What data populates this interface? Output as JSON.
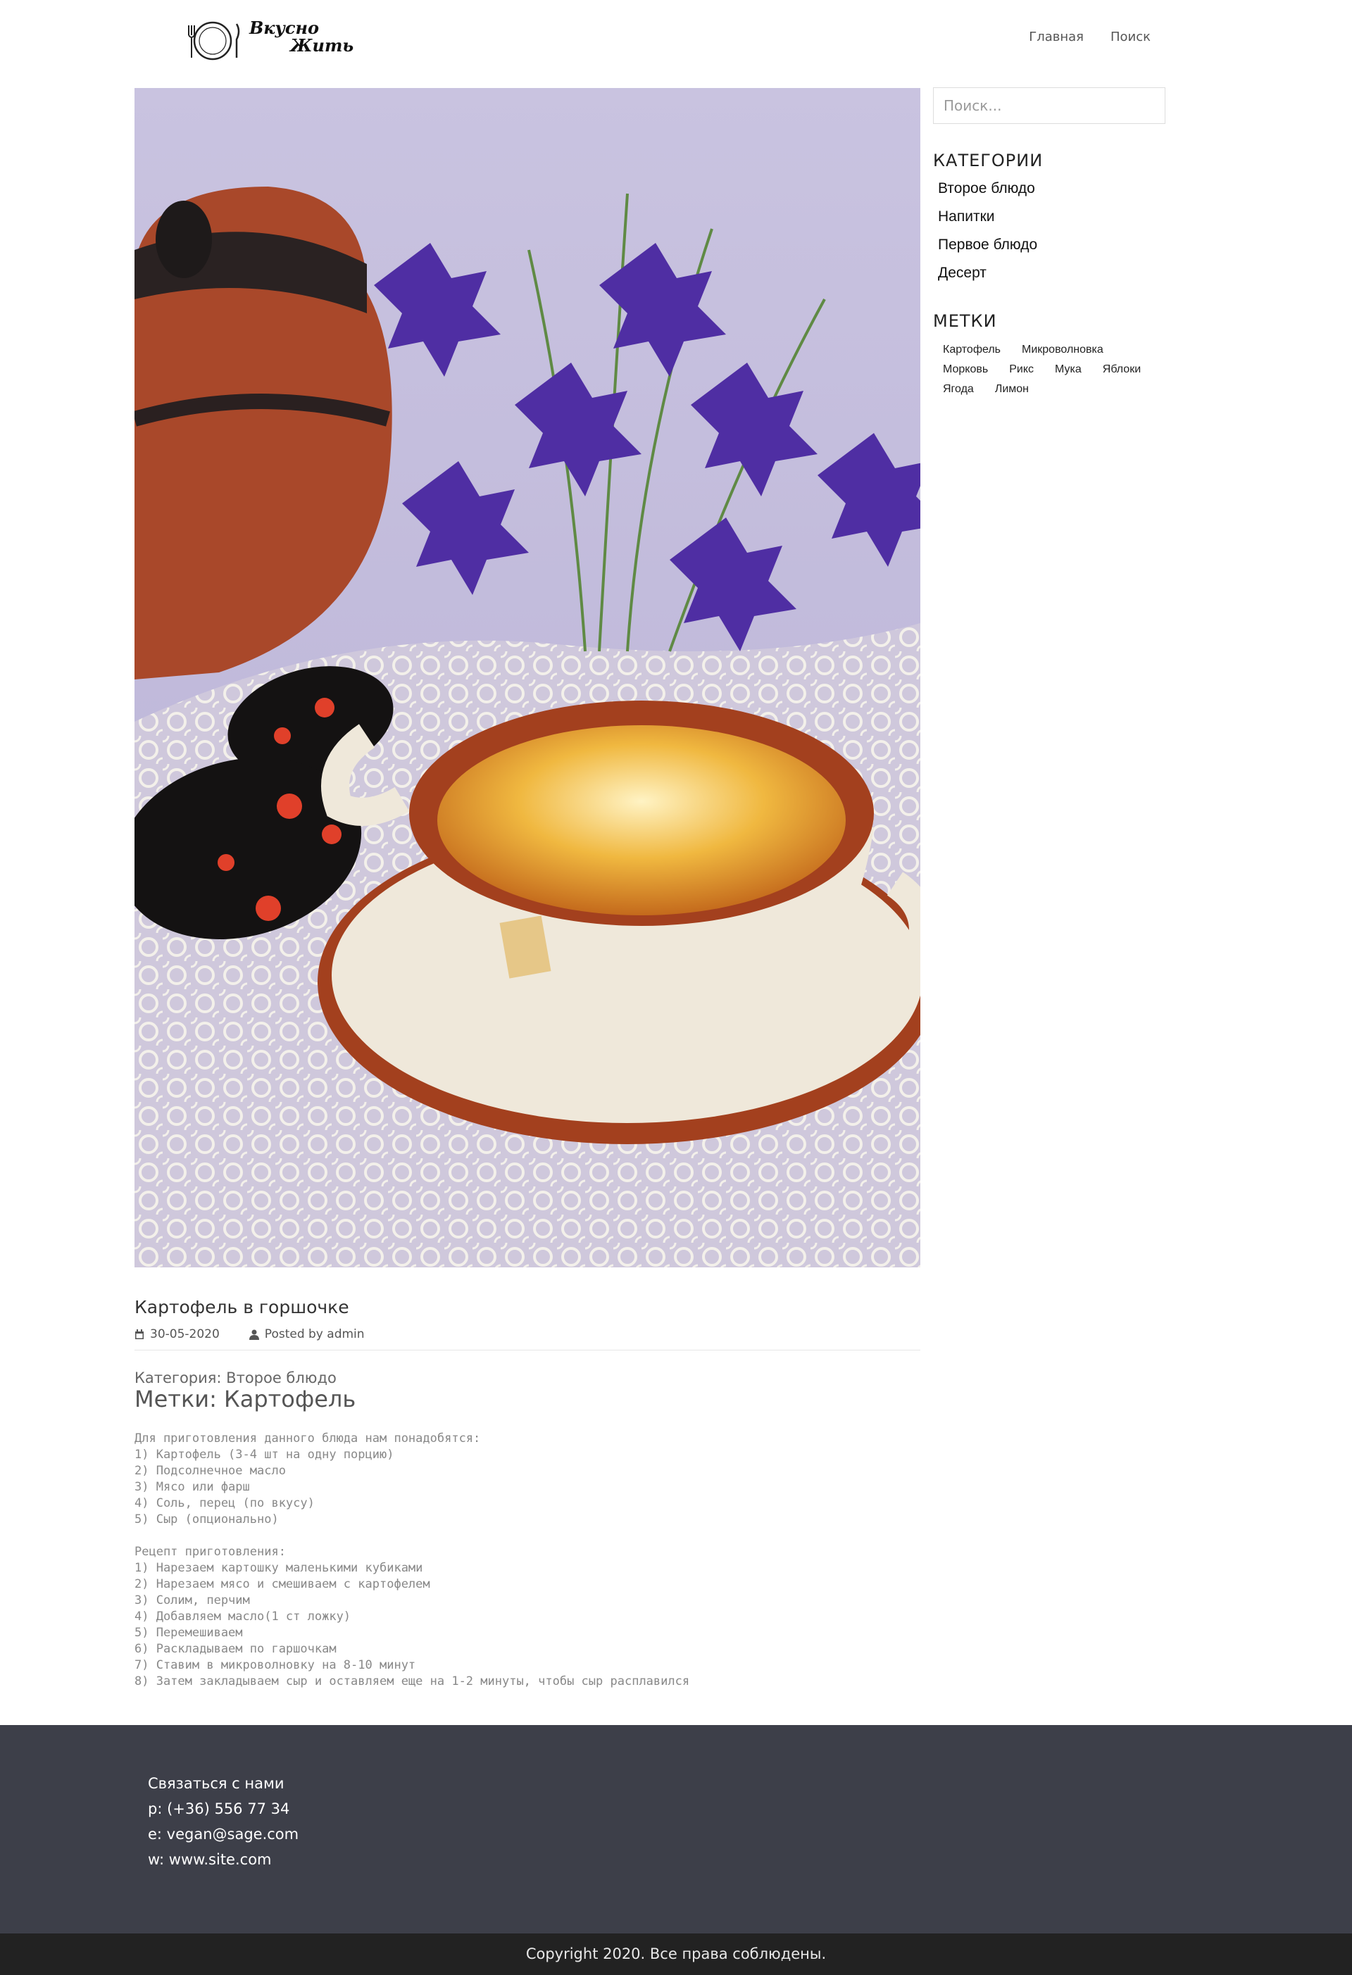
{
  "header": {
    "logo_text_top": "Вкусно",
    "logo_text_bottom": "Жить",
    "nav": [
      {
        "label": "Главная"
      },
      {
        "label": "Поиск"
      }
    ]
  },
  "sidebar": {
    "search_placeholder": "Поиск...",
    "categories_title": "КАТЕГОРИИ",
    "categories": [
      "Второе блюдо",
      "Напитки",
      "Первое блюдо",
      "Десерт"
    ],
    "tags_title": "МЕТКИ",
    "tags": [
      "Картофель",
      "Микроволновка",
      "Морковь",
      "Рикс",
      "Мука",
      "Яблоки",
      "Ягода",
      "Лимон"
    ]
  },
  "post": {
    "title": "Картофель в горшочке",
    "date": "30-05-2020",
    "author": "Posted by admin",
    "category": "Категория: Второе блюдо",
    "tags": "Метки: Картофель",
    "body": "Для приготовления данного блюда нам понадобятся:\n1) Картофель (3-4 шт на одну порцию)\n2) Подсолнечное масло\n3) Мясо или фарш\n4) Соль, перец (по вкусу)\n5) Сыр (опционально)\n\nРецепт приготовления:\n1) Нарезаем картошку маленькими кубиками\n2) Нарезаем мясо и смешиваем с картофелем\n3) Солим, перчим\n4) Добавляем масло(1 ст ложку)\n5) Перемешиваем\n6) Раскладываем по гаршочкам\n7) Ставим в микроволновку на 8-10 минут\n8) Затем закладываем сыр и оставляем еще на 1-2 минуты, чтобы сыр расплавился"
  },
  "footer": {
    "contact_title": "Связаться с нами",
    "phone": "p: (+36) 556 77 34",
    "email": "e: vegan@sage.com",
    "web": "w: www.site.com",
    "copyright": "Copyright 2020. Все права соблюдены."
  },
  "colors": {
    "footer_bg": "#3d3f49",
    "copyright_bg": "#222222"
  }
}
